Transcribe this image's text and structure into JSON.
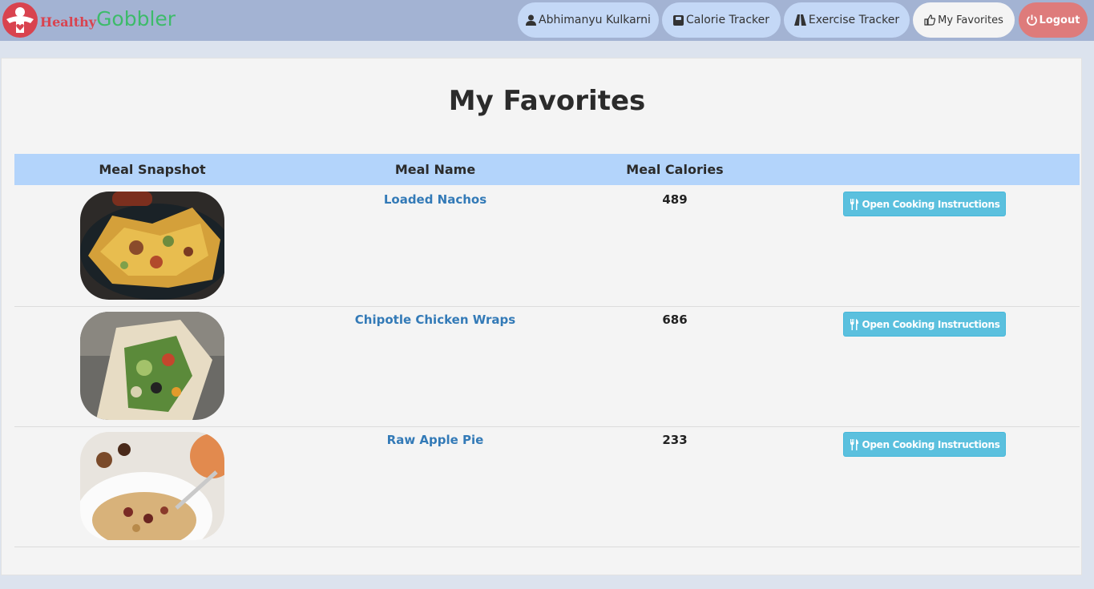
{
  "brand": {
    "part1": "Healthy",
    "part2": "Gobbler"
  },
  "nav": {
    "user": "Abhimanyu Kulkarni",
    "calorie": "Calorie Tracker",
    "exercise": "Exercise Tracker",
    "favorites": "My Favorites",
    "logout": "Logout"
  },
  "page": {
    "title": "My Favorites"
  },
  "table": {
    "headers": [
      "Meal Snapshot",
      "Meal Name",
      "Meal Calories"
    ],
    "button_label": "Open Cooking Instructions",
    "rows": [
      {
        "name": "Loaded Nachos",
        "calories": "489"
      },
      {
        "name": "Chipotle Chicken Wraps",
        "calories": "686"
      },
      {
        "name": "Raw Apple Pie",
        "calories": "233"
      }
    ]
  },
  "colors": {
    "navbar": "#a3b3d3",
    "pill": "#c4d8f6",
    "logout": "#de7b7b",
    "header": "#b3d4fb",
    "link": "#337ab7",
    "button": "#5bc0de"
  },
  "icons": {
    "logo": "heart-person-logo",
    "user": "user-icon",
    "calorie": "scale-icon",
    "exercise": "road-icon",
    "favorites": "thumbs-up-icon",
    "logout": "power-icon",
    "cooking": "cutlery-icon"
  }
}
